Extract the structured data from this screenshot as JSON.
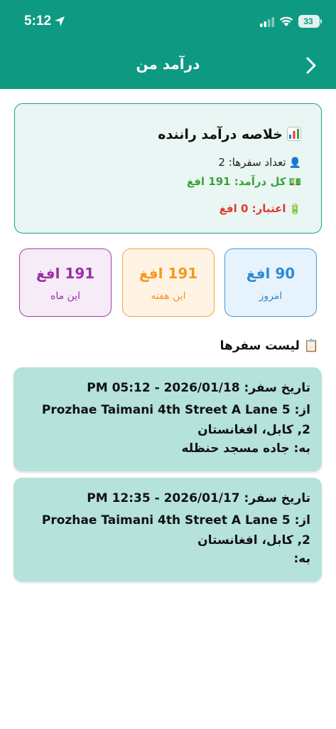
{
  "status_bar": {
    "time": "5:12",
    "battery": "33"
  },
  "header": {
    "title": "درآمد من"
  },
  "summary": {
    "icon": "chart-icon",
    "title": "خلاصه درآمد راننده",
    "trips_emoji": "👤",
    "trips_text": "تعداد سفرها: 2",
    "income_emoji": "💵",
    "income_text": "کل درآمد: 191 افغ",
    "credit_emoji": "🔋",
    "credit_text": "اعتبار: 0 افغ"
  },
  "stats": [
    {
      "value": "90 افغ",
      "label": "امروز"
    },
    {
      "value": "191 افغ",
      "label": "این هفته"
    },
    {
      "value": "191 افغ",
      "label": "این ماه"
    }
  ],
  "trips_title": "📋 لیست سفرها",
  "trips": [
    {
      "date": "تاریخ سفر: 2026/01/18 - 05:12 PM",
      "from_1": "از: Prozhae Taimani 4th Street A Lane 5",
      "from_2": "2, کابل، افغانستان",
      "to": "به: جاده مسجد حنظله"
    },
    {
      "date": "تاریخ سفر: 2026/01/17 - 12:35 PM",
      "from_1": "از: Prozhae Taimani 4th Street A Lane 5",
      "from_2": "2, کابل، افغانستان",
      "to": "به:"
    }
  ],
  "colors": {
    "header": "#0e9a82",
    "today": "#2f8ad6",
    "week": "#f29a1f",
    "month": "#9b30a6",
    "income": "#3aa23a",
    "credit": "#e0392f",
    "trip_card": "#b5e2db"
  }
}
